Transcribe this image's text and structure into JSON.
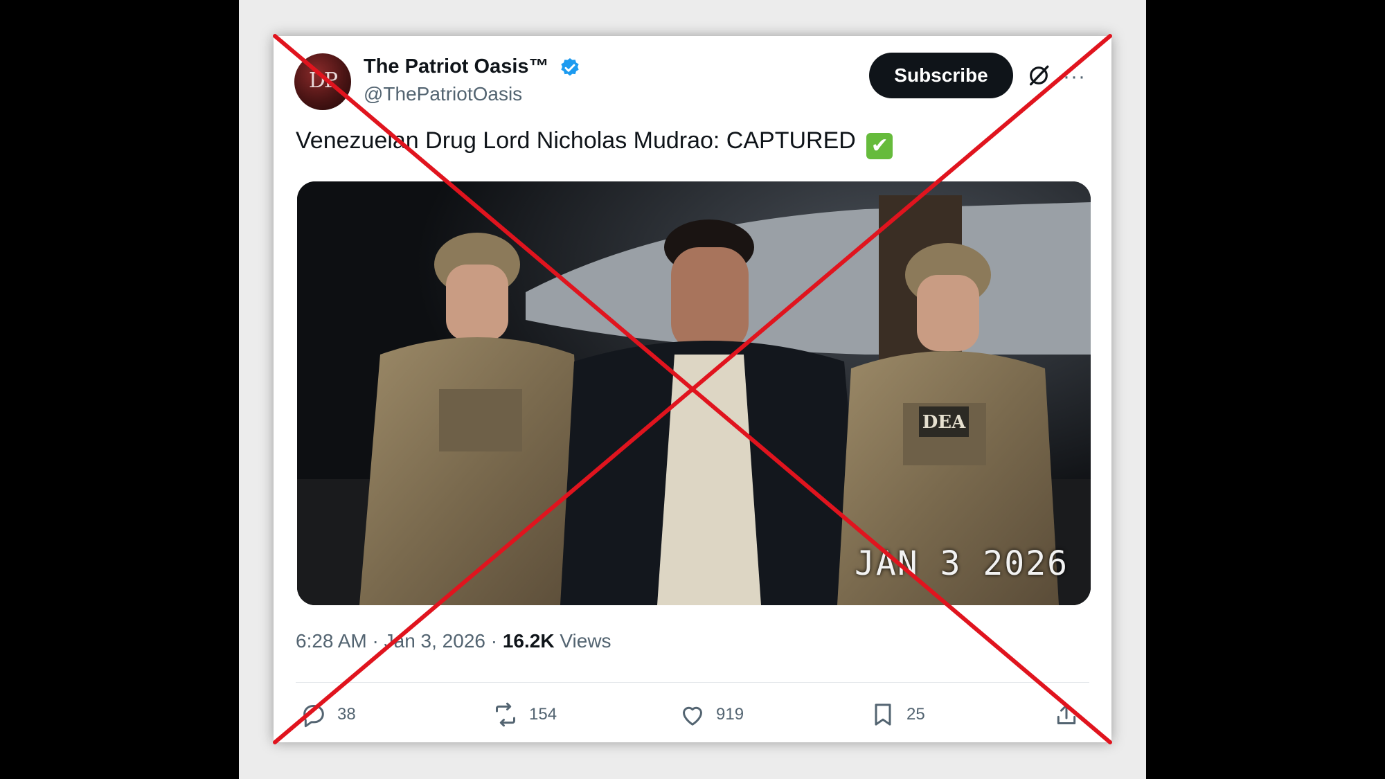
{
  "account": {
    "name": "The Patriot Oasis™",
    "handle": "@ThePatriotOasis",
    "avatar_text": "DP"
  },
  "header": {
    "subscribe_label": "Subscribe",
    "more_label": "···"
  },
  "tweet": {
    "text": "Venezuelan Drug Lord Nicholas Mudrao: CAPTURED",
    "check_emoji": "✔",
    "image_date_stamp": "JAN 3 2026",
    "image_vest_text": "DEA",
    "time": "6:28 AM",
    "date": "Jan 3, 2026",
    "separator": "·",
    "views_count": "16.2K",
    "views_label": "Views"
  },
  "actions": {
    "replies": "38",
    "reposts": "154",
    "likes": "919",
    "bookmarks": "25"
  },
  "colors": {
    "verified": "#1d9bf0",
    "cross": "#e0141e",
    "button": "#0f1419"
  },
  "icons": [
    "verified-icon",
    "grok-icon",
    "more-icon",
    "reply-icon",
    "repost-icon",
    "like-icon",
    "bookmark-icon",
    "share-icon"
  ]
}
